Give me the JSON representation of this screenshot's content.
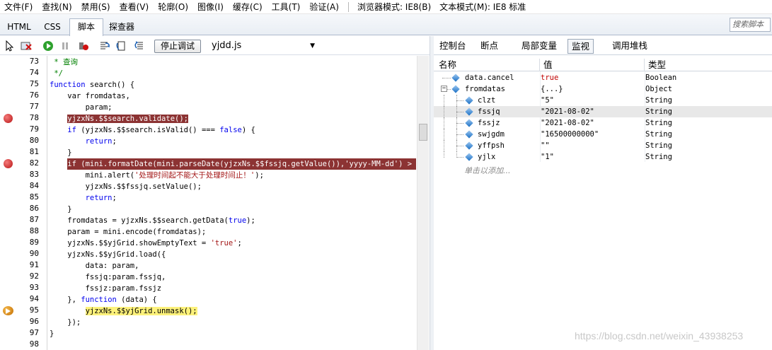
{
  "menu": [
    "文件(F)",
    "查找(N)",
    "禁用(S)",
    "查看(V)",
    "轮廓(O)",
    "图像(I)",
    "缓存(C)",
    "工具(T)",
    "验证(A)"
  ],
  "modes": {
    "browser": "浏览器模式: IE8(B)",
    "document": "文本模式(M): IE8 标准"
  },
  "tabs": [
    "HTML",
    "CSS",
    "脚本",
    "探查器"
  ],
  "search_placeholder": "搜索脚本",
  "toolbar": {
    "stop_debug": "停止调试",
    "file": "yjdd.js",
    "dropdown_arrow": "▼"
  },
  "right_tabs": [
    "控制台",
    "断点",
    "局部变量",
    "监视",
    "调用堆栈"
  ],
  "watch": {
    "headers": {
      "name": "名称",
      "value": "值",
      "type": "类型"
    },
    "rows": [
      {
        "name": "data.cancel",
        "value": "true",
        "type": "Boolean"
      },
      {
        "name": "fromdatas",
        "value": "{...}",
        "type": "Object",
        "expand": "−"
      },
      {
        "name": "clzt",
        "value": "\"5\"",
        "type": "String"
      },
      {
        "name": "fssjq",
        "value": "\"2021-08-02\"",
        "type": "String"
      },
      {
        "name": "fssjz",
        "value": "\"2021-08-02\"",
        "type": "String"
      },
      {
        "name": "swjgdm",
        "value": "\"16500000000\"",
        "type": "String"
      },
      {
        "name": "yffpsh",
        "value": "\"\"",
        "type": "String"
      },
      {
        "name": "yjlx",
        "value": "\"1\"",
        "type": "String"
      }
    ],
    "add_hint": "单击以添加..."
  },
  "code": {
    "line_numbers": [
      "73",
      "74",
      "75",
      "76",
      "77",
      "78",
      "79",
      "80",
      "81",
      "82",
      "83",
      "84",
      "85",
      "86",
      "87",
      "88",
      "89",
      "90",
      "91",
      "92",
      "93",
      "94",
      "95",
      "96",
      "97",
      "98"
    ],
    "lines": [
      {
        "c": [
          " * 查询"
        ]
      },
      {
        "c": [
          " */"
        ]
      },
      {
        "c": [
          "function",
          " search() {"
        ]
      },
      {
        "c": [
          "    var fromdatas,"
        ]
      },
      {
        "c": [
          "        param;"
        ]
      },
      {
        "c": [
          "    ",
          "yjzxNs.$$search.validate();"
        ]
      },
      {
        "c": [
          "    if",
          " (yjzxNs.$$search.isValid() === ",
          "false",
          ") {"
        ]
      },
      {
        "c": [
          "        ",
          "return",
          ";"
        ]
      },
      {
        "c": [
          "    }"
        ]
      },
      {
        "c": [
          "    ",
          "if (mini.formatDate(mini.parseDate(yjzxNs.$$fssjq.getValue()),'yyyy-MM-dd') > mini."
        ]
      },
      {
        "c": [
          "        mini.alert(",
          "'处理时间起不能大于处理时间止！'",
          ");"
        ]
      },
      {
        "c": [
          "        yjzxNs.$$fssjq.setValue();"
        ]
      },
      {
        "c": [
          "        ",
          "return",
          ";"
        ]
      },
      {
        "c": [
          "    }"
        ]
      },
      {
        "c": [
          "    fromdatas = yjzxNs.$$search.getData(",
          "true",
          ");"
        ]
      },
      {
        "c": [
          "    param = mini.encode(fromdatas);"
        ]
      },
      {
        "c": [
          "    yjzxNs.$$yjGrid.showEmptyText = ",
          "'true'",
          ";"
        ]
      },
      {
        "c": [
          "    yjzxNs.$$yjGrid.load({"
        ]
      },
      {
        "c": [
          "        data: param,"
        ]
      },
      {
        "c": [
          "        fssjq:param.fssjq,"
        ]
      },
      {
        "c": [
          "        fssjz:param.fssjz"
        ]
      },
      {
        "c": [
          "    }, ",
          "function",
          " (data) {"
        ]
      },
      {
        "c": [
          "        ",
          "yjzxNs.$$yjGrid.unmask();"
        ]
      },
      {
        "c": [
          "    });"
        ]
      },
      {
        "c": [
          "}"
        ]
      },
      {
        "c": [
          ""
        ]
      }
    ]
  },
  "watermark": "https://blog.csdn.net/weixin_43938253",
  "colors": {
    "breakpoint_line": "#8c3333",
    "current_line": "#fdf27b",
    "keyword": "#0000ee",
    "comment": "#008000"
  }
}
